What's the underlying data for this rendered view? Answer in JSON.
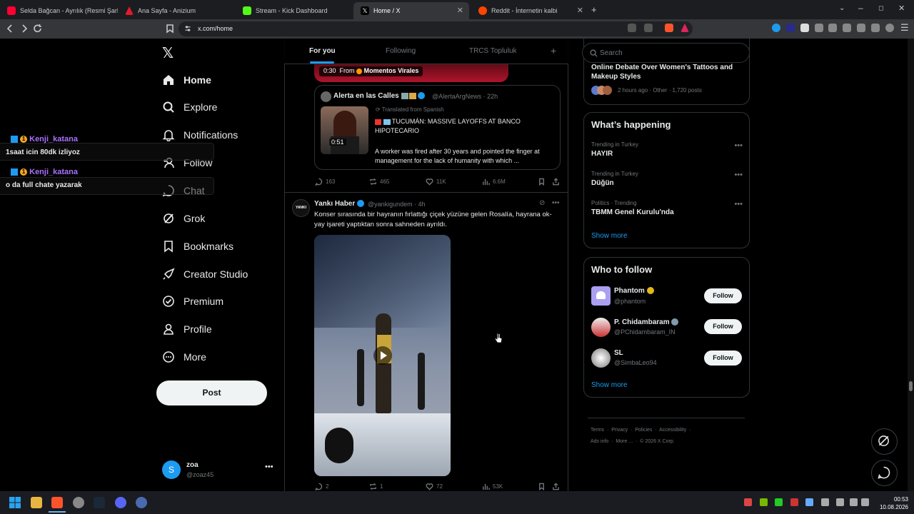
{
  "browser": {
    "tabs": [
      {
        "label": "Selda Bağcan - Ayrılık (Resmi Şarkı...",
        "color": "#ff0033"
      },
      {
        "label": "Ana Sayfa - Anizium",
        "color": "#e01b2d"
      },
      {
        "label": "Stream - Kick Dashboard",
        "color": "#53fc18"
      },
      {
        "label": "Home / X",
        "color": "#000000"
      },
      {
        "label": "Reddit - İnternetin kalbi",
        "color": "#ff4500"
      }
    ],
    "url": "x.com/home"
  },
  "overlay_chat": [
    {
      "user": "Kenji_katana",
      "badge": "1",
      "message": "1saat icin 80dk izliyoz"
    },
    {
      "user": "Kenji_katana",
      "badge": "1",
      "message": "o da full chate yazarak"
    }
  ],
  "nav": {
    "items": [
      "Home",
      "Explore",
      "Notifications",
      "Follow",
      "Chat",
      "Grok",
      "Bookmarks",
      "Creator Studio",
      "Premium",
      "Profile",
      "More"
    ],
    "post_label": "Post",
    "account": {
      "name": "zoa",
      "handle": "@zoaz45",
      "initial": "S"
    }
  },
  "feed": {
    "tabs": [
      "For you",
      "Following",
      "TRCS Topluluk"
    ],
    "top_video": {
      "time": "0:30",
      "from_label": "From",
      "from_name": "Momentos Virales"
    },
    "quote": {
      "name": "Alerta en las Calles",
      "handle": "@AlertaArgNews · 22h",
      "translated": "Translated from Spanish",
      "video_time": "0:51",
      "headline": "TUCUMÁN: MASSIVE LAYOFFS AT BANCO HIPOTECARIO",
      "body": "A worker was fired after 30 years and pointed the finger at management for the lack of humanity with which ..."
    },
    "tweet1_actions": {
      "replies": "163",
      "reposts": "465",
      "likes": "11K",
      "views": "6.6M"
    },
    "tweet2": {
      "avatar": "YANKI",
      "name": "Yankı Haber",
      "handle": "@yankigundem · 4h",
      "text": "Konser sırasında bir hayranın fırlattığı çiçek yüzüne gelen Rosalía, hayrana ok-yay işareti yaptıktan sonra sahneden ayrıldı."
    },
    "tweet2_actions": {
      "replies": "2",
      "reposts": "1",
      "likes": "72",
      "views": "53K"
    }
  },
  "right": {
    "search_placeholder": "Search",
    "partial_trend": {
      "title": "Online Debate Over Women's Tattoos and Makeup Styles",
      "meta": "2 hours ago · Other · 1,720 posts"
    },
    "happening_title": "What’s happening",
    "trends": [
      {
        "sub": "Trending in Turkey",
        "title": "HAYIR"
      },
      {
        "sub": "Trending in Turkey",
        "title": "Düğün"
      },
      {
        "sub": "Politics · Trending",
        "title": "TBMM Genel Kurulu'nda"
      }
    ],
    "show_more": "Show more",
    "wtf_title": "Who to follow",
    "who_to_follow": [
      {
        "name": "Phantom",
        "handle": "@phantom",
        "badge_color": "#e2b719"
      },
      {
        "name": "P. Chidambaram",
        "handle": "@PChidambaram_IN",
        "badge_color": "#829aab"
      },
      {
        "name": "SL",
        "handle": "@SimbaLeo94",
        "badge_color": ""
      }
    ],
    "follow_label": "Follow",
    "footer_line1": [
      "Terms",
      "Privacy",
      "Policies",
      "Accessibility"
    ],
    "footer_line2": [
      "Ads info",
      "More ...",
      "© 2026 X Corp."
    ]
  },
  "taskbar": {
    "time": "00:53",
    "date": "10.08.2026"
  },
  "colors": {
    "accent": "#1d9bf0",
    "chat_user": "#a970ff"
  }
}
